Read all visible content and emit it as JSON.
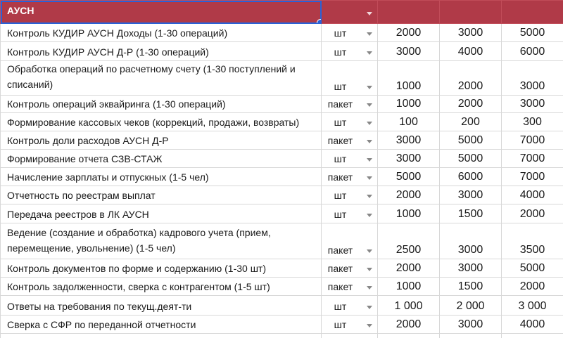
{
  "section_title": "АУСН",
  "rows": [
    {
      "name": "Контроль КУДИР АУСН Доходы (1-30 операций)",
      "unit": "шт",
      "p1": "2000",
      "p2": "3000",
      "p3": "5000"
    },
    {
      "name": "Контроль КУДИР АУСН Д-Р (1-30 операций)",
      "unit": "шт",
      "p1": "3000",
      "p2": "4000",
      "p3": "6000"
    },
    {
      "name": "Обработка операций по расчетному счету (1-30 поступлений и списаний)",
      "unit": "шт",
      "p1": "1000",
      "p2": "2000",
      "p3": "3000"
    },
    {
      "name": "Контроль операций эквайринга (1-30 операций)",
      "unit": "пакет",
      "p1": "1000",
      "p2": "2000",
      "p3": "3000"
    },
    {
      "name": "Формирование кассовых чеков (коррекций, продажи, возвраты)",
      "unit": "шт",
      "p1": "100",
      "p2": "200",
      "p3": "300"
    },
    {
      "name": "Контроль доли расходов АУСН Д-Р",
      "unit": "пакет",
      "p1": "3000",
      "p2": "5000",
      "p3": "7000"
    },
    {
      "name": "Формирование отчета СЗВ-СТАЖ",
      "unit": "шт",
      "p1": "3000",
      "p2": "5000",
      "p3": "7000"
    },
    {
      "name": "Начисление зарплаты и  отпускных (1-5 чел)",
      "unit": "пакет",
      "p1": "5000",
      "p2": "6000",
      "p3": "7000"
    },
    {
      "name": "Отчетность по реестрам выплат",
      "unit": "шт",
      "p1": "2000",
      "p2": "3000",
      "p3": "4000"
    },
    {
      "name": "Передача реестров в ЛК АУСН",
      "unit": "шт",
      "p1": "1000",
      "p2": "1500",
      "p3": "2000"
    },
    {
      "name": "Ведение (создание и обработка) кадрового учета (прием, перемещение, увольнение) (1-5 чел)",
      "unit": "пакет",
      "p1": "2500",
      "p2": "3000",
      "p3": "3500"
    },
    {
      "name": "Контроль документов по форме и содержанию (1-30 шт)",
      "unit": "пакет",
      "p1": "2000",
      "p2": "3000",
      "p3": "5000"
    },
    {
      "name": "Контроль  задолженности, сверка с контрагентом (1-5 шт)",
      "unit": "пакет",
      "p1": "1000",
      "p2": "1500",
      "p3": "2000"
    },
    {
      "name": "Ответы на требования по текущ.деят-ти",
      "unit": "шт",
      "p1": "1 000",
      "p2": "2 000",
      "p3": "3 000"
    },
    {
      "name": "Сверка с СФР по переданной отчетности",
      "unit": "шт",
      "p1": "2000",
      "p2": "3000",
      "p3": "4000"
    }
  ]
}
